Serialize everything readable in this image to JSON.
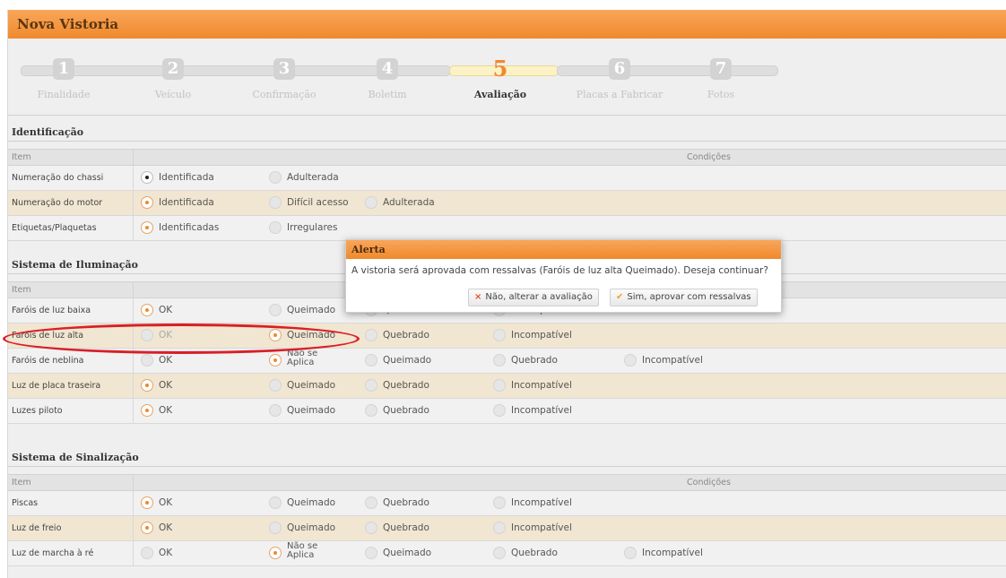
{
  "title": "Nova Vistoria",
  "steps": [
    {
      "num": "1",
      "label": "Finalidade"
    },
    {
      "num": "2",
      "label": "Veículo"
    },
    {
      "num": "3",
      "label": "Confirmação"
    },
    {
      "num": "4",
      "label": "Boletim"
    },
    {
      "num": "5",
      "label": "Avaliação",
      "active": true
    },
    {
      "num": "6",
      "label": "Placas a Fabricar"
    },
    {
      "num": "7",
      "label": "Fotos"
    }
  ],
  "sections": [
    {
      "title": "Identificação",
      "header": {
        "item": "Item",
        "conditions": "Condições"
      },
      "rows": [
        {
          "name": "Numeração do chassi",
          "options": [
            {
              "label": "Identificada",
              "state": "dark"
            },
            {
              "label": "Adulterada"
            }
          ]
        },
        {
          "name": "Numeração do motor",
          "options": [
            {
              "label": "Identificada",
              "state": "sel"
            },
            {
              "label": "Difícil acesso"
            },
            {
              "label": "Adulterada"
            }
          ]
        },
        {
          "name": "Etiquetas/Plaquetas",
          "options": [
            {
              "label": "Identificadas",
              "state": "sel"
            },
            {
              "label": "Irregulares"
            }
          ]
        }
      ]
    },
    {
      "title": "Sistema de Iluminação",
      "header": {
        "item": "Item",
        "conditions": ""
      },
      "rows": [
        {
          "name": "Faróis de luz baixa",
          "options": [
            {
              "label": "OK",
              "state": "sel"
            },
            {
              "label": "Queimado"
            },
            {
              "label": "Quebrado"
            },
            {
              "label": "Incompatível"
            }
          ]
        },
        {
          "name": "Faróis de luz alta",
          "options": [
            {
              "label": "OK",
              "muted": true
            },
            {
              "label": "Queimado",
              "state": "sel"
            },
            {
              "label": "Quebrado"
            },
            {
              "label": "Incompatível"
            }
          ]
        },
        {
          "name": "Faróis de neblina",
          "options": [
            {
              "label": "OK"
            },
            {
              "label": "Não se Aplica",
              "state": "sel"
            },
            {
              "label": "Queimado"
            },
            {
              "label": "Quebrado"
            },
            {
              "label": "Incompatível"
            }
          ]
        },
        {
          "name": "Luz de placa traseira",
          "options": [
            {
              "label": "OK",
              "state": "sel"
            },
            {
              "label": "Queimado"
            },
            {
              "label": "Quebrado"
            },
            {
              "label": "Incompatível"
            }
          ]
        },
        {
          "name": "Luzes piloto",
          "options": [
            {
              "label": "OK",
              "state": "sel"
            },
            {
              "label": "Queimado"
            },
            {
              "label": "Quebrado"
            },
            {
              "label": "Incompatível"
            }
          ]
        }
      ]
    },
    {
      "title": "Sistema de Sinalização",
      "header": {
        "item": "Item",
        "conditions": "Condições"
      },
      "rows": [
        {
          "name": "Piscas",
          "options": [
            {
              "label": "OK",
              "state": "sel"
            },
            {
              "label": "Queimado"
            },
            {
              "label": "Quebrado"
            },
            {
              "label": "Incompatível"
            }
          ]
        },
        {
          "name": "Luz de freio",
          "options": [
            {
              "label": "OK",
              "state": "sel"
            },
            {
              "label": "Queimado"
            },
            {
              "label": "Quebrado"
            },
            {
              "label": "Incompatível"
            }
          ]
        },
        {
          "name": "Luz de marcha à ré",
          "options": [
            {
              "label": "OK"
            },
            {
              "label": "Não se Aplica",
              "state": "sel"
            },
            {
              "label": "Queimado"
            },
            {
              "label": "Quebrado"
            },
            {
              "label": "Incompatível"
            }
          ]
        }
      ]
    }
  ],
  "dialog": {
    "title": "Alerta",
    "message": "A vistoria será aprovada com ressalvas (Faróis de luz alta Queimado). Deseja continuar?",
    "cancel_label": "Não, alterar a avaliação",
    "confirm_label": "Sim, aprovar com ressalvas",
    "cancel_icon": "close-icon",
    "confirm_icon": "check-icon"
  },
  "colors": {
    "accent": "#ef8a2c",
    "row_alt": "#f1e6d2",
    "highlight": "#d81f26"
  }
}
